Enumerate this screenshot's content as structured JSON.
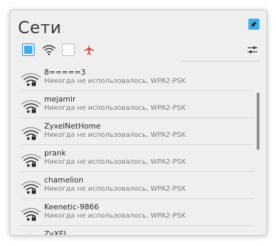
{
  "panel": {
    "title": "Сети"
  },
  "toolbar": {
    "wireless_enabled": true,
    "mobile_enabled": false,
    "icons": [
      "wifi-icon",
      "airplane-icon",
      "settings-icon"
    ],
    "airplane_color": "#e53935",
    "accent_color": "#3daee9"
  },
  "networks": [
    {
      "name": "8=====3",
      "status": "Никогда не использовалось, WPA2-PSK"
    },
    {
      "name": "mejamir",
      "status": "Никогда не использовалось, WPA2-PSK"
    },
    {
      "name": "ZyxelNetHome",
      "status": "Никогда не использовалось, WPA2-PSK"
    },
    {
      "name": "prank",
      "status": "Никогда не использовалось, WPA2-PSK"
    },
    {
      "name": "chamelion",
      "status": "Никогда не использовалось, WPA2-PSK"
    },
    {
      "name": "Keenetic-9866",
      "status": "Никогда не использовалось, WPA2-PSK"
    },
    {
      "name": "ZyXEL",
      "status": ""
    }
  ]
}
